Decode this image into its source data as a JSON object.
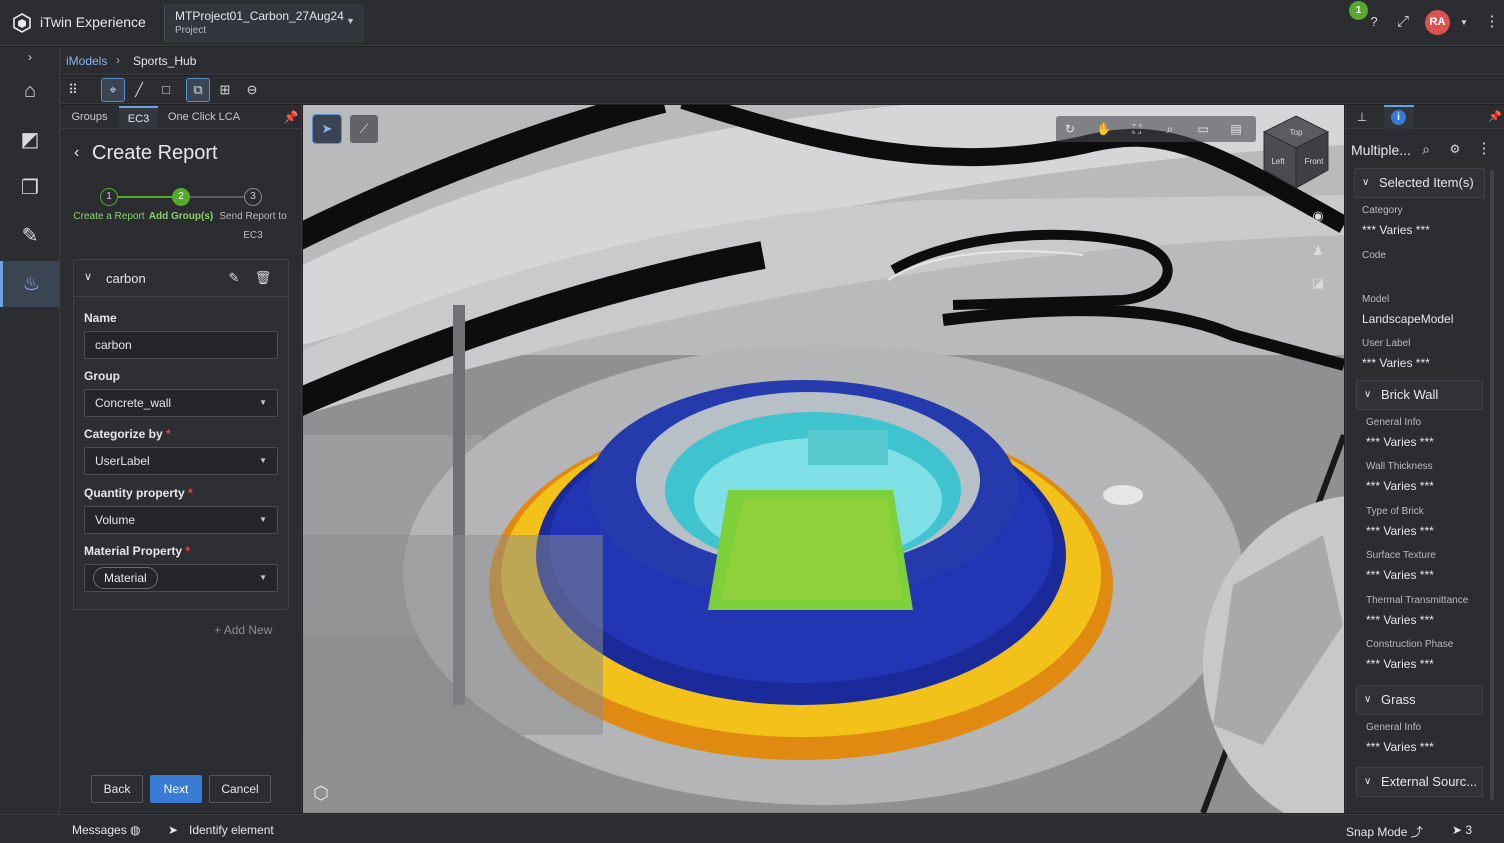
{
  "app": {
    "title": "iTwin Experience",
    "project_name": "MTProject01_Carbon_27Aug24",
    "project_type": "Project",
    "notification_count": "1",
    "user_initials": "RA"
  },
  "breadcrumb": {
    "root": "iModels",
    "current": "Sports_Hub"
  },
  "left_panel": {
    "tabs": [
      "Groups",
      "EC3",
      "One Click LCA"
    ],
    "active_tab": "EC3",
    "title": "Create Report",
    "steps": [
      {
        "num": "1",
        "label": "Create a Report"
      },
      {
        "num": "2",
        "label": "Add Group(s)"
      },
      {
        "num": "3",
        "label": "Send Report to EC3"
      }
    ],
    "active_step": 2,
    "group_name": "carbon",
    "form": {
      "name_label": "Name",
      "name_value": "carbon",
      "group_label": "Group",
      "group_value": "Concrete_wall",
      "categorize_label": "Categorize by",
      "categorize_value": "UserLabel",
      "quantity_label": "Quantity property",
      "quantity_value": "Volume",
      "material_label": "Material Property",
      "material_value": "Material",
      "required_mark": "*"
    },
    "add_new": "Add New",
    "buttons": {
      "back": "Back",
      "next": "Next",
      "cancel": "Cancel"
    }
  },
  "viewport": {
    "cube_faces": {
      "top": "Top",
      "left": "Left",
      "front": "Front"
    }
  },
  "right_panel": {
    "header": "Multiple...",
    "selected_section": "Selected Item(s)",
    "selected_props": [
      {
        "label": "Category",
        "value": "*** Varies ***"
      },
      {
        "label": "Code",
        "value": ""
      },
      {
        "label": "Model",
        "value": "LandscapeModel"
      },
      {
        "label": "User Label",
        "value": "*** Varies ***"
      }
    ],
    "brick_section": "Brick Wall",
    "brick_props": [
      {
        "label": "General Info",
        "value": "*** Varies ***"
      },
      {
        "label": "Wall Thickness",
        "value": "*** Varies ***"
      },
      {
        "label": "Type of Brick",
        "value": "*** Varies ***"
      },
      {
        "label": "Surface Texture",
        "value": "*** Varies ***"
      },
      {
        "label": "Thermal Transmittance",
        "value": "*** Varies ***"
      },
      {
        "label": "Construction Phase",
        "value": "*** Varies ***"
      }
    ],
    "grass_section": "Grass",
    "grass_props": [
      {
        "label": "General Info",
        "value": "*** Varies ***"
      }
    ],
    "external_section": "External Sourc..."
  },
  "status": {
    "messages": "Messages",
    "tool": "Identify element",
    "snap": "Snap Mode",
    "selection_count": "3"
  },
  "colors": {
    "accent": "#3a7bd5",
    "success": "#56a82f",
    "danger": "#d9534f",
    "field": "#8fd13a",
    "stands": "#1b2a9a"
  }
}
